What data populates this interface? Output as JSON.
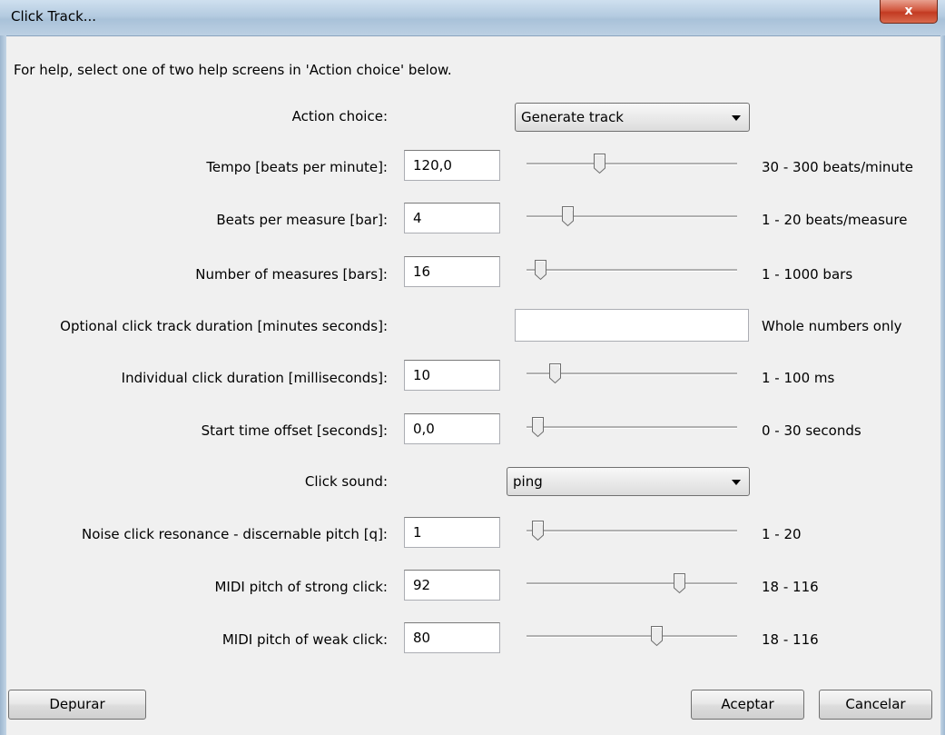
{
  "window": {
    "title": "Click Track...",
    "close_glyph": "x"
  },
  "help_text": "For help, select one of two help screens in 'Action choice' below.",
  "action_choice": {
    "label": "Action choice:",
    "value": "Generate track"
  },
  "tempo": {
    "label": "Tempo [beats per minute]:",
    "value": "120,0",
    "range": "30 - 300 beats/minute",
    "level": 0.33
  },
  "beats_per_measure": {
    "label": "Beats per measure [bar]:",
    "value": "4",
    "range": "1 - 20 beats/measure",
    "level": 0.16
  },
  "measures": {
    "label": "Number of measures [bars]:",
    "value": "16",
    "range": "1 - 1000 bars",
    "level": 0.015
  },
  "duration": {
    "label": "Optional click track duration [minutes seconds]:",
    "value": "",
    "range": "Whole numbers only"
  },
  "click_duration": {
    "label": "Individual click duration [milliseconds]:",
    "value": "10",
    "range": "1 - 100 ms",
    "level": 0.09
  },
  "start_offset": {
    "label": "Start time offset [seconds]:",
    "value": "0,0",
    "range": "0 - 30 seconds",
    "level": 0.0
  },
  "click_sound": {
    "label": "Click sound:",
    "value": "ping"
  },
  "noise_resonance": {
    "label": "Noise click resonance - discernable pitch [q]:",
    "value": "1",
    "range": "1 - 20",
    "level": 0.0
  },
  "midi_strong": {
    "label": "MIDI pitch of strong click:",
    "value": "92",
    "range": "18 - 116",
    "level": 0.755
  },
  "midi_weak": {
    "label": "MIDI pitch of weak click:",
    "value": "80",
    "range": "18 - 116",
    "level": 0.633
  },
  "buttons": {
    "debug": "Depurar",
    "ok": "Aceptar",
    "cancel": "Cancelar"
  }
}
